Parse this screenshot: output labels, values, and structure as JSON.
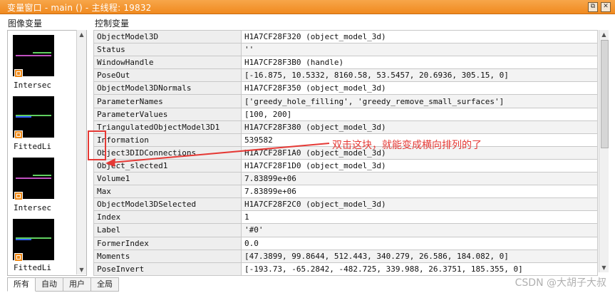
{
  "window": {
    "title": "变量窗口 - main () - 主线程: 19832",
    "restore_icon": "restore-icon",
    "close_icon": "close-icon"
  },
  "image_panel": {
    "heading": "图像变量",
    "items": [
      {
        "label": "Intersec"
      },
      {
        "label": "FittedLi"
      },
      {
        "label": "Intersec"
      },
      {
        "label": "FittedLi"
      }
    ]
  },
  "control_panel": {
    "heading": "控制变量",
    "rows": [
      {
        "name": "ObjectModel3D",
        "value": "H1A7CF28F320 (object_model_3d)"
      },
      {
        "name": "Status",
        "value": "''"
      },
      {
        "name": "WindowHandle",
        "value": "H1A7CF28F3B0 (handle)"
      },
      {
        "name": "PoseOut",
        "value": "[-16.875, 10.5332, 8160.58, 53.5457, 20.6936, 305.15, 0]"
      },
      {
        "name": "ObjectModel3DNormals",
        "value": "H1A7CF28F350 (object_model_3d)"
      },
      {
        "name": "ParameterNames",
        "value": "['greedy_hole_filling', 'greedy_remove_small_surfaces']"
      },
      {
        "name": "ParameterValues",
        "value": "[100, 200]"
      },
      {
        "name": "TriangulatedObjectModel3D1",
        "value": "H1A7CF28F380 (object_model_3d)"
      },
      {
        "name": "Information",
        "value": "539582"
      },
      {
        "name": "Object3DIDConnections",
        "value": "H1A7CF28F1A0 (object_model_3d)"
      },
      {
        "name": "Object_slected1",
        "value": "H1A7CF28F1D0 (object_model_3d)"
      },
      {
        "name": "Volume1",
        "value": "7.83899e+06"
      },
      {
        "name": "Max",
        "value": "7.83899e+06"
      },
      {
        "name": "ObjectModel3DSelected",
        "value": "H1A7CF28F2C0 (object_model_3d)"
      },
      {
        "name": "Index",
        "value": "1"
      },
      {
        "name": "Label",
        "value": "'#0'"
      },
      {
        "name": "FormerIndex",
        "value": "0.0"
      },
      {
        "name": "Moments",
        "value": "[47.3899, 99.8644, 512.443, 340.279, 26.586, 184.082, 0]"
      },
      {
        "name": "PoseInvert",
        "value": "[-193.73, -65.2842, -482.725, 339.988, 26.3751, 185.355, 0]"
      }
    ]
  },
  "annotation": {
    "text": "双击这块，就能变成横向排列的了",
    "color": "#e53935"
  },
  "tabs": [
    "所有",
    "自动",
    "用户",
    "全局"
  ],
  "watermark": "CSDN @大胡子大叔"
}
